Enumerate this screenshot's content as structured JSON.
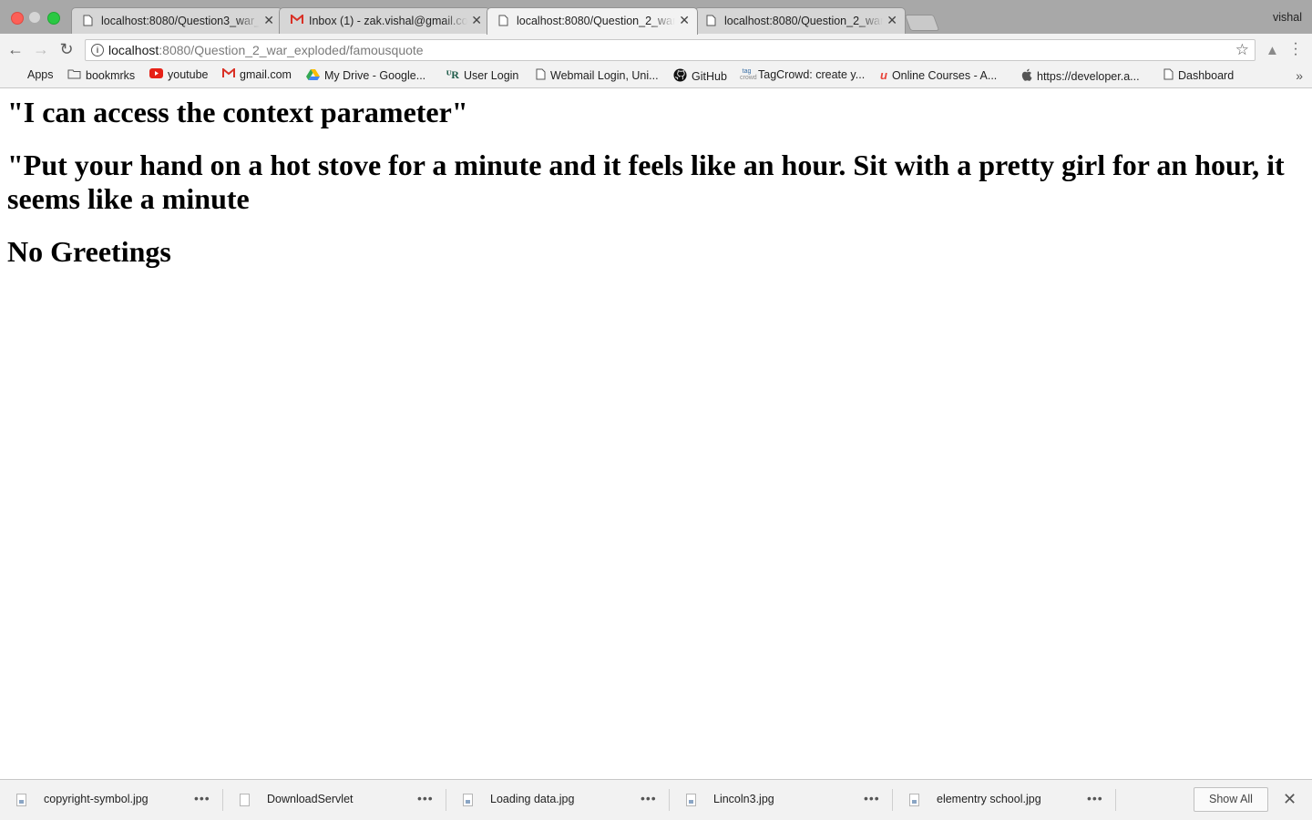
{
  "browser": {
    "profile_name": "vishal",
    "tabs": [
      {
        "title": "localhost:8080/Question3_war_exploded/",
        "icon": "page-icon",
        "active": false
      },
      {
        "title": "Inbox (1) - zak.vishal@gmail.com",
        "icon": "gmail-icon",
        "active": false
      },
      {
        "title": "localhost:8080/Question_2_war_exploded/",
        "icon": "page-icon",
        "active": true
      },
      {
        "title": "localhost:8080/Question_2_war_exploded/",
        "icon": "page-icon",
        "active": false
      }
    ],
    "address": {
      "host": "localhost",
      "path": ":8080/Question_2_war_exploded/famousquote"
    },
    "bookmarks": [
      {
        "label": "Apps",
        "icon": "apps-grid-icon"
      },
      {
        "label": "bookmrks",
        "icon": "folder-icon"
      },
      {
        "label": "youtube",
        "icon": "youtube-icon"
      },
      {
        "label": "gmail.com",
        "icon": "gmail-icon"
      },
      {
        "label": "My Drive - Google...",
        "icon": "google-drive-icon"
      },
      {
        "label": "User Login",
        "icon": "ur-logo-icon"
      },
      {
        "label": "Webmail Login, Uni...",
        "icon": "page-icon"
      },
      {
        "label": "GitHub",
        "icon": "github-icon"
      },
      {
        "label": "TagCrowd: create y...",
        "icon": "tagcrowd-icon"
      },
      {
        "label": "Online Courses - A...",
        "icon": "udemy-icon"
      },
      {
        "label": "https://developer.a...",
        "icon": "apple-icon"
      },
      {
        "label": "Dashboard",
        "icon": "page-icon"
      }
    ]
  },
  "page": {
    "headings": [
      "\"I can access the context parameter\"",
      "\"Put your hand on a hot stove for a minute and it feels like an hour. Sit with a pretty girl for an hour, it seems like a minute",
      "No Greetings"
    ]
  },
  "downloads": {
    "items": [
      {
        "name": "copyright-symbol.jpg",
        "icon": "image-file-icon"
      },
      {
        "name": "DownloadServlet",
        "icon": "file-icon"
      },
      {
        "name": "Loading data.jpg",
        "icon": "image-file-icon"
      },
      {
        "name": "Lincoln3.jpg",
        "icon": "image-file-icon"
      },
      {
        "name": "elementry school.jpg",
        "icon": "image-file-icon"
      }
    ],
    "show_all_label": "Show All"
  }
}
